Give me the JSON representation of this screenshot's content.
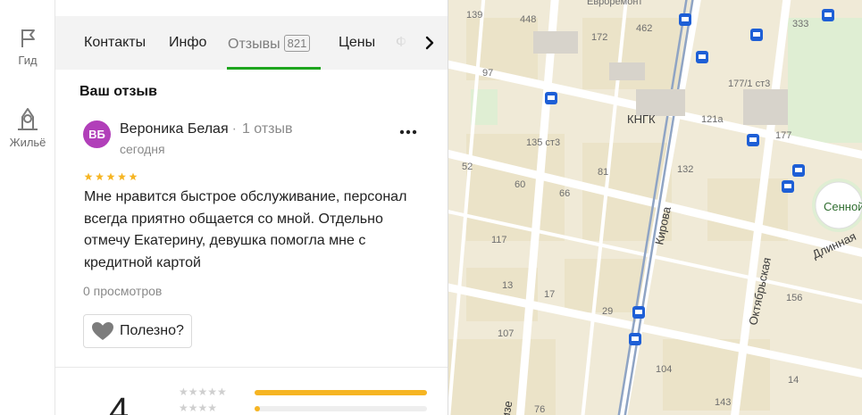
{
  "rail": {
    "items": [
      {
        "label": "Гид",
        "icon": "flag-icon"
      },
      {
        "label": "Жильё",
        "icon": "building-icon"
      }
    ]
  },
  "tabs": {
    "items": [
      {
        "label": "Контакты"
      },
      {
        "label": "Инфо"
      },
      {
        "label": "Отзывы",
        "badge": "821",
        "active": true
      },
      {
        "label": "Цены"
      },
      {
        "label": "Ф"
      }
    ]
  },
  "review": {
    "section_title": "Ваш отзыв",
    "avatar_initials": "ВБ",
    "avatar_color": "#b13fb9",
    "author": "Вероника Белая",
    "separator": "·",
    "reviews_count": "1 отзыв",
    "date": "сегодня",
    "rating": 5,
    "text": "Мне нравится быстрое обслуживание, персонал всегда приятно общается со мной. Отдельно отмечу Екатерину, девушка помогла мне с кредитной картой",
    "views": "0 просмотров",
    "useful_label": "Полезно?"
  },
  "summary": {
    "rating": "4",
    "distribution": [
      {
        "stars": 5,
        "fraction": 1.0
      },
      {
        "stars": 4,
        "fraction": 0.03
      }
    ]
  },
  "map": {
    "accent_color": "#1e5fd6",
    "labels": [
      "139",
      "448",
      "Евроремонт",
      "462",
      "333",
      "172",
      "97",
      "177/1 ст3",
      "КНГК",
      "121а",
      "177",
      "135 ст3",
      "81",
      "132",
      "52",
      "60",
      "66",
      "Сенной",
      "Кирова",
      "Длинная",
      "117",
      "Октябрьская",
      "13",
      "17",
      "156",
      "29",
      "107",
      "104",
      "14",
      "143",
      "изе",
      "76"
    ]
  }
}
